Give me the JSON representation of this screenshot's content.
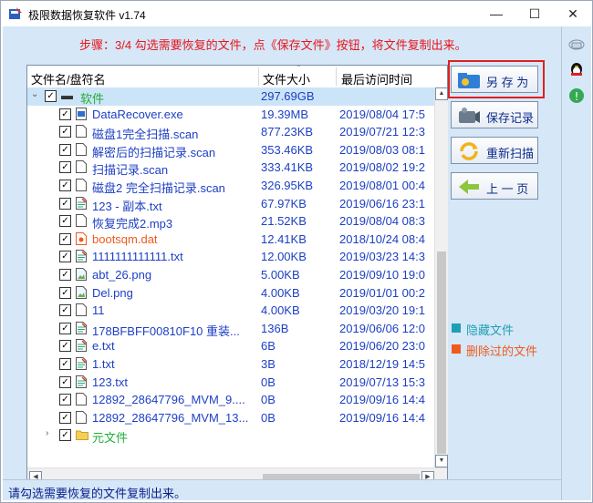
{
  "window": {
    "title": "极限数据恢复软件 v1.74",
    "minimize": "—",
    "maximize": "☐",
    "close": "✕"
  },
  "step_text": "步骤：3/4 勾选需要恢复的文件，点《保存文件》按钮，将文件复制出来。",
  "columns": {
    "name": "文件名/盘符名",
    "size": "文件大小",
    "date": "最后访问时间"
  },
  "root": {
    "name": "软件",
    "size": "297.69GB"
  },
  "files": [
    {
      "name": "DataRecover.exe",
      "size": "19.39MB",
      "date": "2019/08/04 17:5",
      "icon": "exe-icon"
    },
    {
      "name": "磁盘1完全扫描.scan",
      "size": "877.23KB",
      "date": "2019/07/21 12:3",
      "icon": "blank-file-icon"
    },
    {
      "name": "解密后的扫描记录.scan",
      "size": "353.46KB",
      "date": "2019/08/03 08:1",
      "icon": "blank-file-icon"
    },
    {
      "name": "扫描记录.scan",
      "size": "333.41KB",
      "date": "2019/08/02 19:2",
      "icon": "blank-file-icon"
    },
    {
      "name": "磁盘2 完全扫描记录.scan",
      "size": "326.95KB",
      "date": "2019/08/01 00:4",
      "icon": "blank-file-icon"
    },
    {
      "name": "123 - 副本.txt",
      "size": "67.97KB",
      "date": "2019/06/16 23:1",
      "icon": "text-file-icon"
    },
    {
      "name": "恢复完成2.mp3",
      "size": "21.52KB",
      "date": "2019/08/04 08:3",
      "icon": "blank-file-icon"
    },
    {
      "name": "bootsqm.dat",
      "size": "12.41KB",
      "date": "2018/10/24 08:4",
      "icon": "deleted-file-icon",
      "deleted": true
    },
    {
      "name": "1111111111111.txt",
      "size": "12.00KB",
      "date": "2019/03/23 14:3",
      "icon": "text-file-icon"
    },
    {
      "name": "abt_26.png",
      "size": "5.00KB",
      "date": "2019/09/10 19:0",
      "icon": "image-file-icon"
    },
    {
      "name": "Del.png",
      "size": "4.00KB",
      "date": "2019/01/01 00:2",
      "icon": "image-file-icon"
    },
    {
      "name": "11",
      "size": "4.00KB",
      "date": "2019/03/20 19:1",
      "icon": "blank-file-icon"
    },
    {
      "name": "178BFBFF00810F10  重装...",
      "size": "136B",
      "date": "2019/06/06 12:0",
      "icon": "text-file-icon"
    },
    {
      "name": "e.txt",
      "size": "6B",
      "date": "2019/06/20 23:0",
      "icon": "text-file-icon"
    },
    {
      "name": "1.txt",
      "size": "3B",
      "date": "2018/12/19 14:5",
      "icon": "text-file-icon"
    },
    {
      "name": "123.txt",
      "size": "0B",
      "date": "2019/07/13 15:3",
      "icon": "text-file-icon"
    },
    {
      "name": "12892_28647796_MVM_9....",
      "size": "0B",
      "date": "2019/09/16 14:4",
      "icon": "blank-file-icon"
    },
    {
      "name": "12892_28647796_MVM_13...",
      "size": "0B",
      "date": "2019/09/16 14:4",
      "icon": "blank-file-icon"
    }
  ],
  "folder2": {
    "name": "元文件"
  },
  "buttons": {
    "save_as": "另 存 为",
    "save_record": "保存记录",
    "rescan": "重新扫描",
    "prev_page": "上 一 页"
  },
  "legend": {
    "hidden": "隐藏文件",
    "deleted": "删除过的文件",
    "hidden_color": "#1ea0b4",
    "deleted_color": "#f05a1e"
  },
  "status": "请勾选需要恢复的文件复制出来。",
  "colors": {
    "accent": "#d6e7f7",
    "step_red": "#e8141b",
    "file_blue": "#1d3fc4",
    "root_green": "#1fae35"
  }
}
